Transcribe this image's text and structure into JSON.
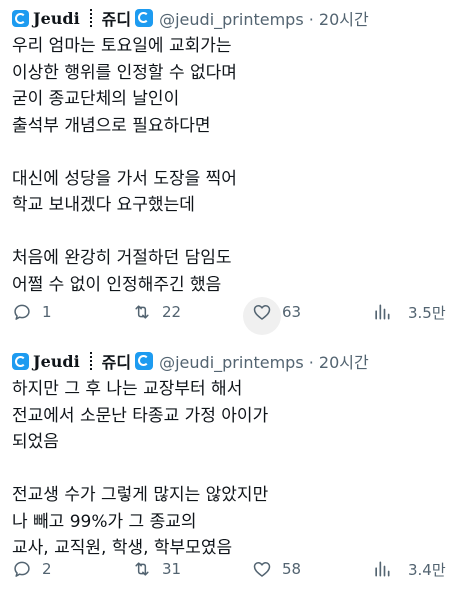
{
  "tweets": [
    {
      "brand": "Jeudi",
      "display_name": "쥬디",
      "handle_time": "@jeudi_printemps · 20시간",
      "text": "우리 엄마는 토요일에 교회가는\n이상한 행위를 인정할 수 없다며\n굳이 종교단체의 날인이\n출석부 개념으로 필요하다면\n\n대신에 성당을 가서 도장을 찍어\n학교 보내겠다 요구했는데\n\n처음에 완강히 거절하던 담임도\n어쩔 수 없이 인정해주긴 했음",
      "replies": "1",
      "retweets": "22",
      "likes": "63",
      "views": "3.5만"
    },
    {
      "brand": "Jeudi",
      "display_name": "쥬디",
      "handle_time": "@jeudi_printemps · 20시간",
      "text": "하지만 그 후 나는 교장부터 해서\n전교에서 소문난 타종교 가정 아이가\n되었음\n\n전교생 수가 그렇게 많지는 않았지만\n나 빼고 99%가 그 종교의\n교사, 교직원, 학생, 학부모였음",
      "replies": "2",
      "retweets": "31",
      "likes": "58",
      "views": "3.4만"
    }
  ],
  "colors": {
    "accent": "#1d9bf0",
    "muted": "#536471",
    "text": "#0f1419"
  }
}
